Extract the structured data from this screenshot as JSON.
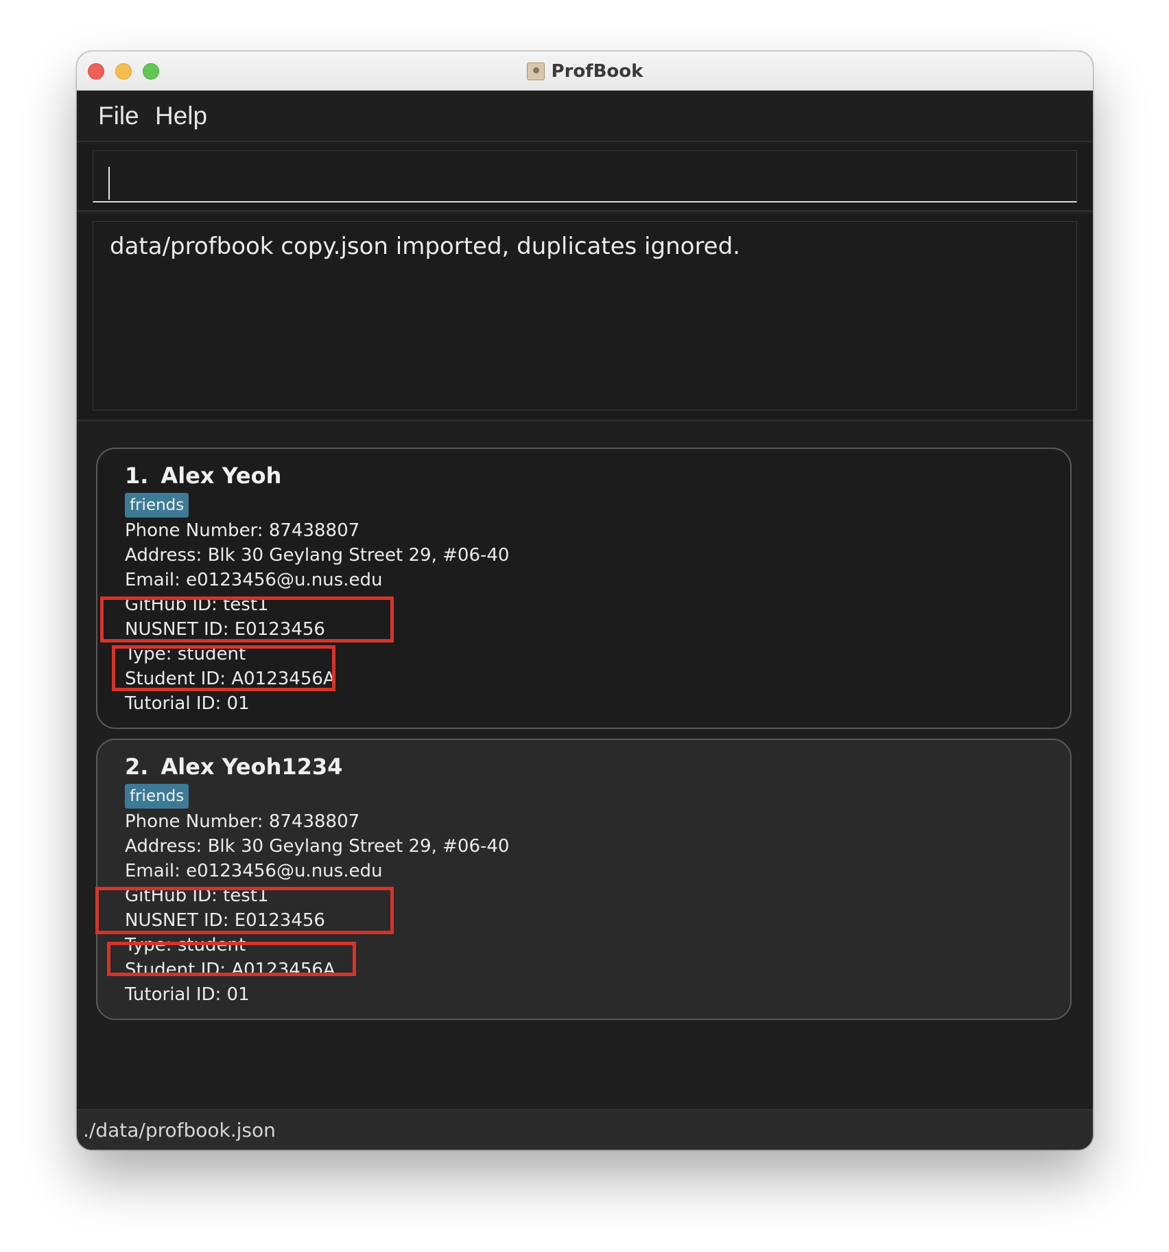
{
  "window": {
    "title": "ProfBook",
    "menu": [
      {
        "label": "File"
      },
      {
        "label": "Help"
      }
    ]
  },
  "command_box": {
    "value": "",
    "placeholder": ""
  },
  "result_display": {
    "message": "data/profbook copy.json imported, duplicates ignored."
  },
  "persons": [
    {
      "index": "1.",
      "name": "Alex Yeoh",
      "tag": "friends",
      "phone": "Phone Number: 87438807",
      "address": "Address: Blk 30 Geylang Street 29, #06-40",
      "email": "Email: e0123456@u.nus.edu",
      "github": "GitHub ID: test1",
      "nusnet": "NUSNET ID: E0123456",
      "type": "Type: student",
      "student_id": "Student ID: A0123456A",
      "tutorial_id": "Tutorial ID: 01"
    },
    {
      "index": "2.",
      "name": "Alex Yeoh1234",
      "tag": "friends",
      "phone": "Phone Number: 87438807",
      "address": "Address: Blk 30 Geylang Street 29, #06-40",
      "email": "Email: e0123456@u.nus.edu",
      "github": "GitHub ID: test1",
      "nusnet": "NUSNET ID: E0123456",
      "type": "Type: student",
      "student_id": "Student ID: A0123456A",
      "tutorial_id": "Tutorial ID: 01"
    }
  ],
  "status_bar": {
    "file_path": "./data/profbook.json"
  },
  "colors": {
    "highlight": "#d8332a",
    "tag_background": "#3d7a96",
    "window_background": "#1e1e1e"
  }
}
